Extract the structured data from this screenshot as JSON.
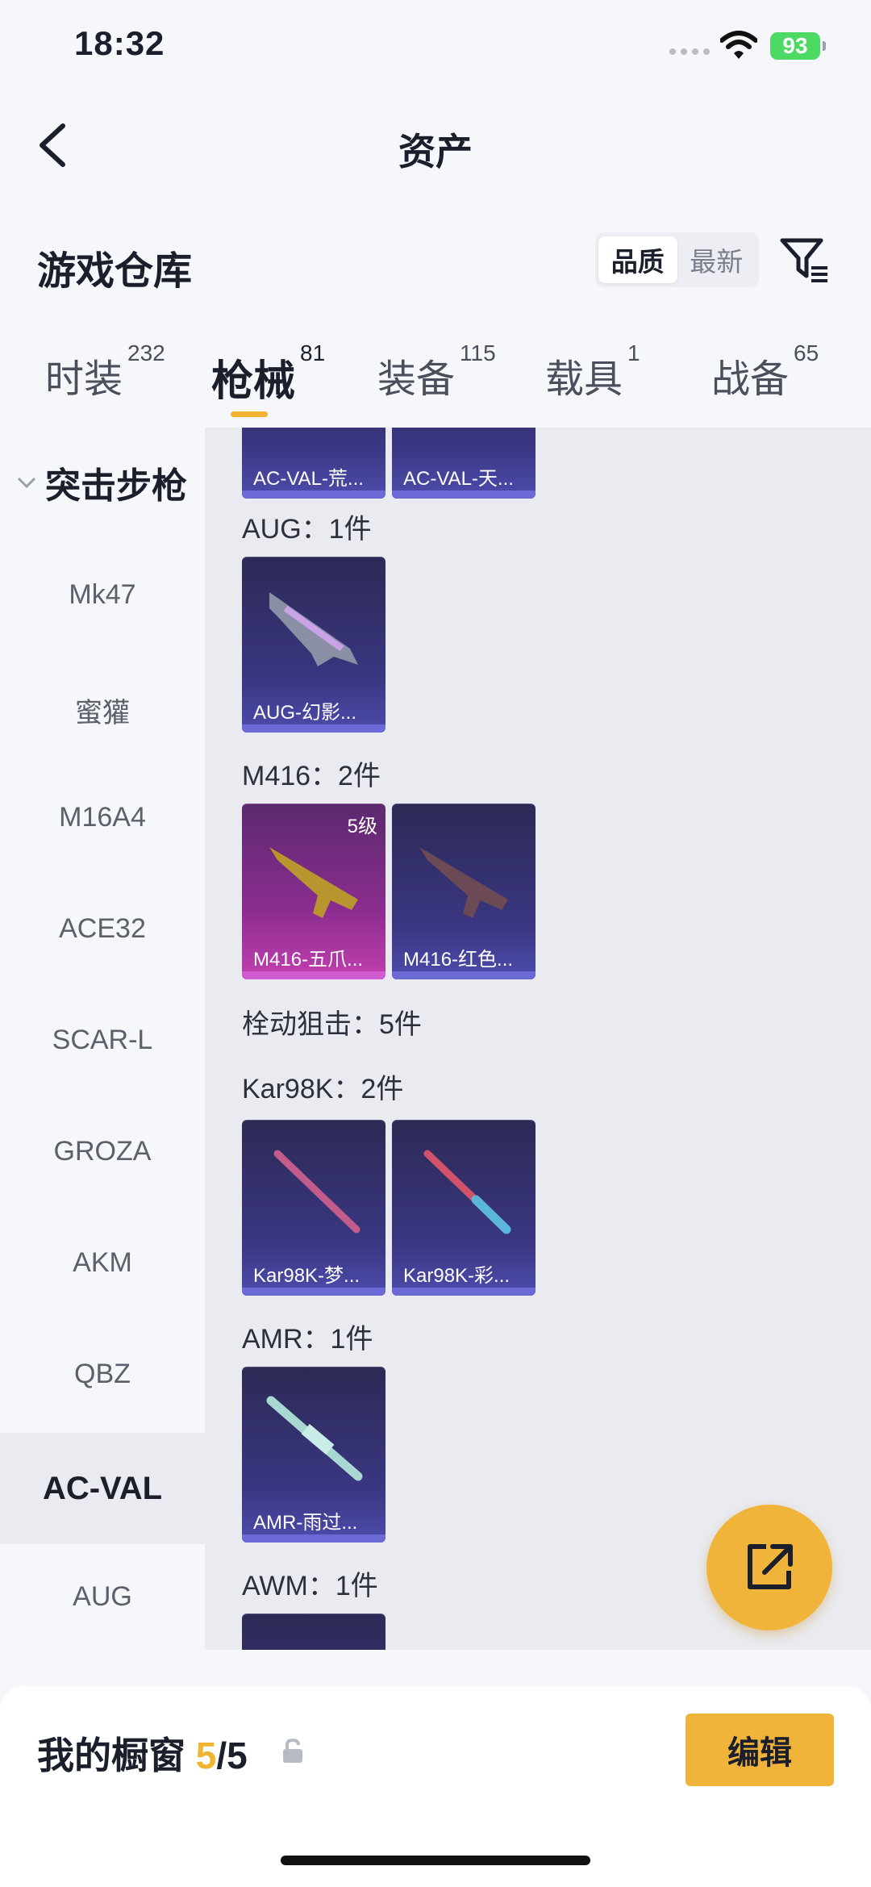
{
  "status_bar": {
    "time": "18:32",
    "battery": "93"
  },
  "nav": {
    "title": "资产"
  },
  "section": {
    "title": "游戏仓库",
    "sort_options": [
      "品质",
      "最新"
    ],
    "sort_selected": "品质"
  },
  "tabs": [
    {
      "label": "时装",
      "count": "232"
    },
    {
      "label": "枪械",
      "count": "81"
    },
    {
      "label": "装备",
      "count": "115"
    },
    {
      "label": "载具",
      "count": "1"
    },
    {
      "label": "战备",
      "count": "65"
    }
  ],
  "sidebar": {
    "category": "突击步枪",
    "items": [
      "Mk47",
      "蜜獾",
      "M16A4",
      "ACE32",
      "SCAR-L",
      "GROZA",
      "AKM",
      "QBZ",
      "AC-VAL",
      "AUG"
    ],
    "selected": "AC-VAL"
  },
  "content": {
    "top_cards": [
      "AC-VAL-荒...",
      "AC-VAL-天..."
    ],
    "groups": [
      {
        "title": "AUG：1件",
        "cards": [
          {
            "label": "AUG-幻影..."
          }
        ]
      },
      {
        "title": "M416：2件",
        "cards": [
          {
            "label": "M416-五爪...",
            "level": "5级"
          },
          {
            "label": "M416-红色..."
          }
        ]
      },
      {
        "title": "栓动狙击：5件"
      },
      {
        "title": "Kar98K：2件",
        "cards": [
          {
            "label": "Kar98K-梦..."
          },
          {
            "label": "Kar98K-彩..."
          }
        ]
      },
      {
        "title": "AMR：1件",
        "cards": [
          {
            "label": "AMR-雨过..."
          }
        ]
      },
      {
        "title": "AWM：1件"
      }
    ]
  },
  "showcase": {
    "label": "我的橱窗",
    "current": "5",
    "total": "/5",
    "edit_label": "编辑"
  },
  "colors": {
    "accent": "#f1b43b",
    "card_purple": "#3a3682",
    "card_legend": "#8b2c8f"
  }
}
